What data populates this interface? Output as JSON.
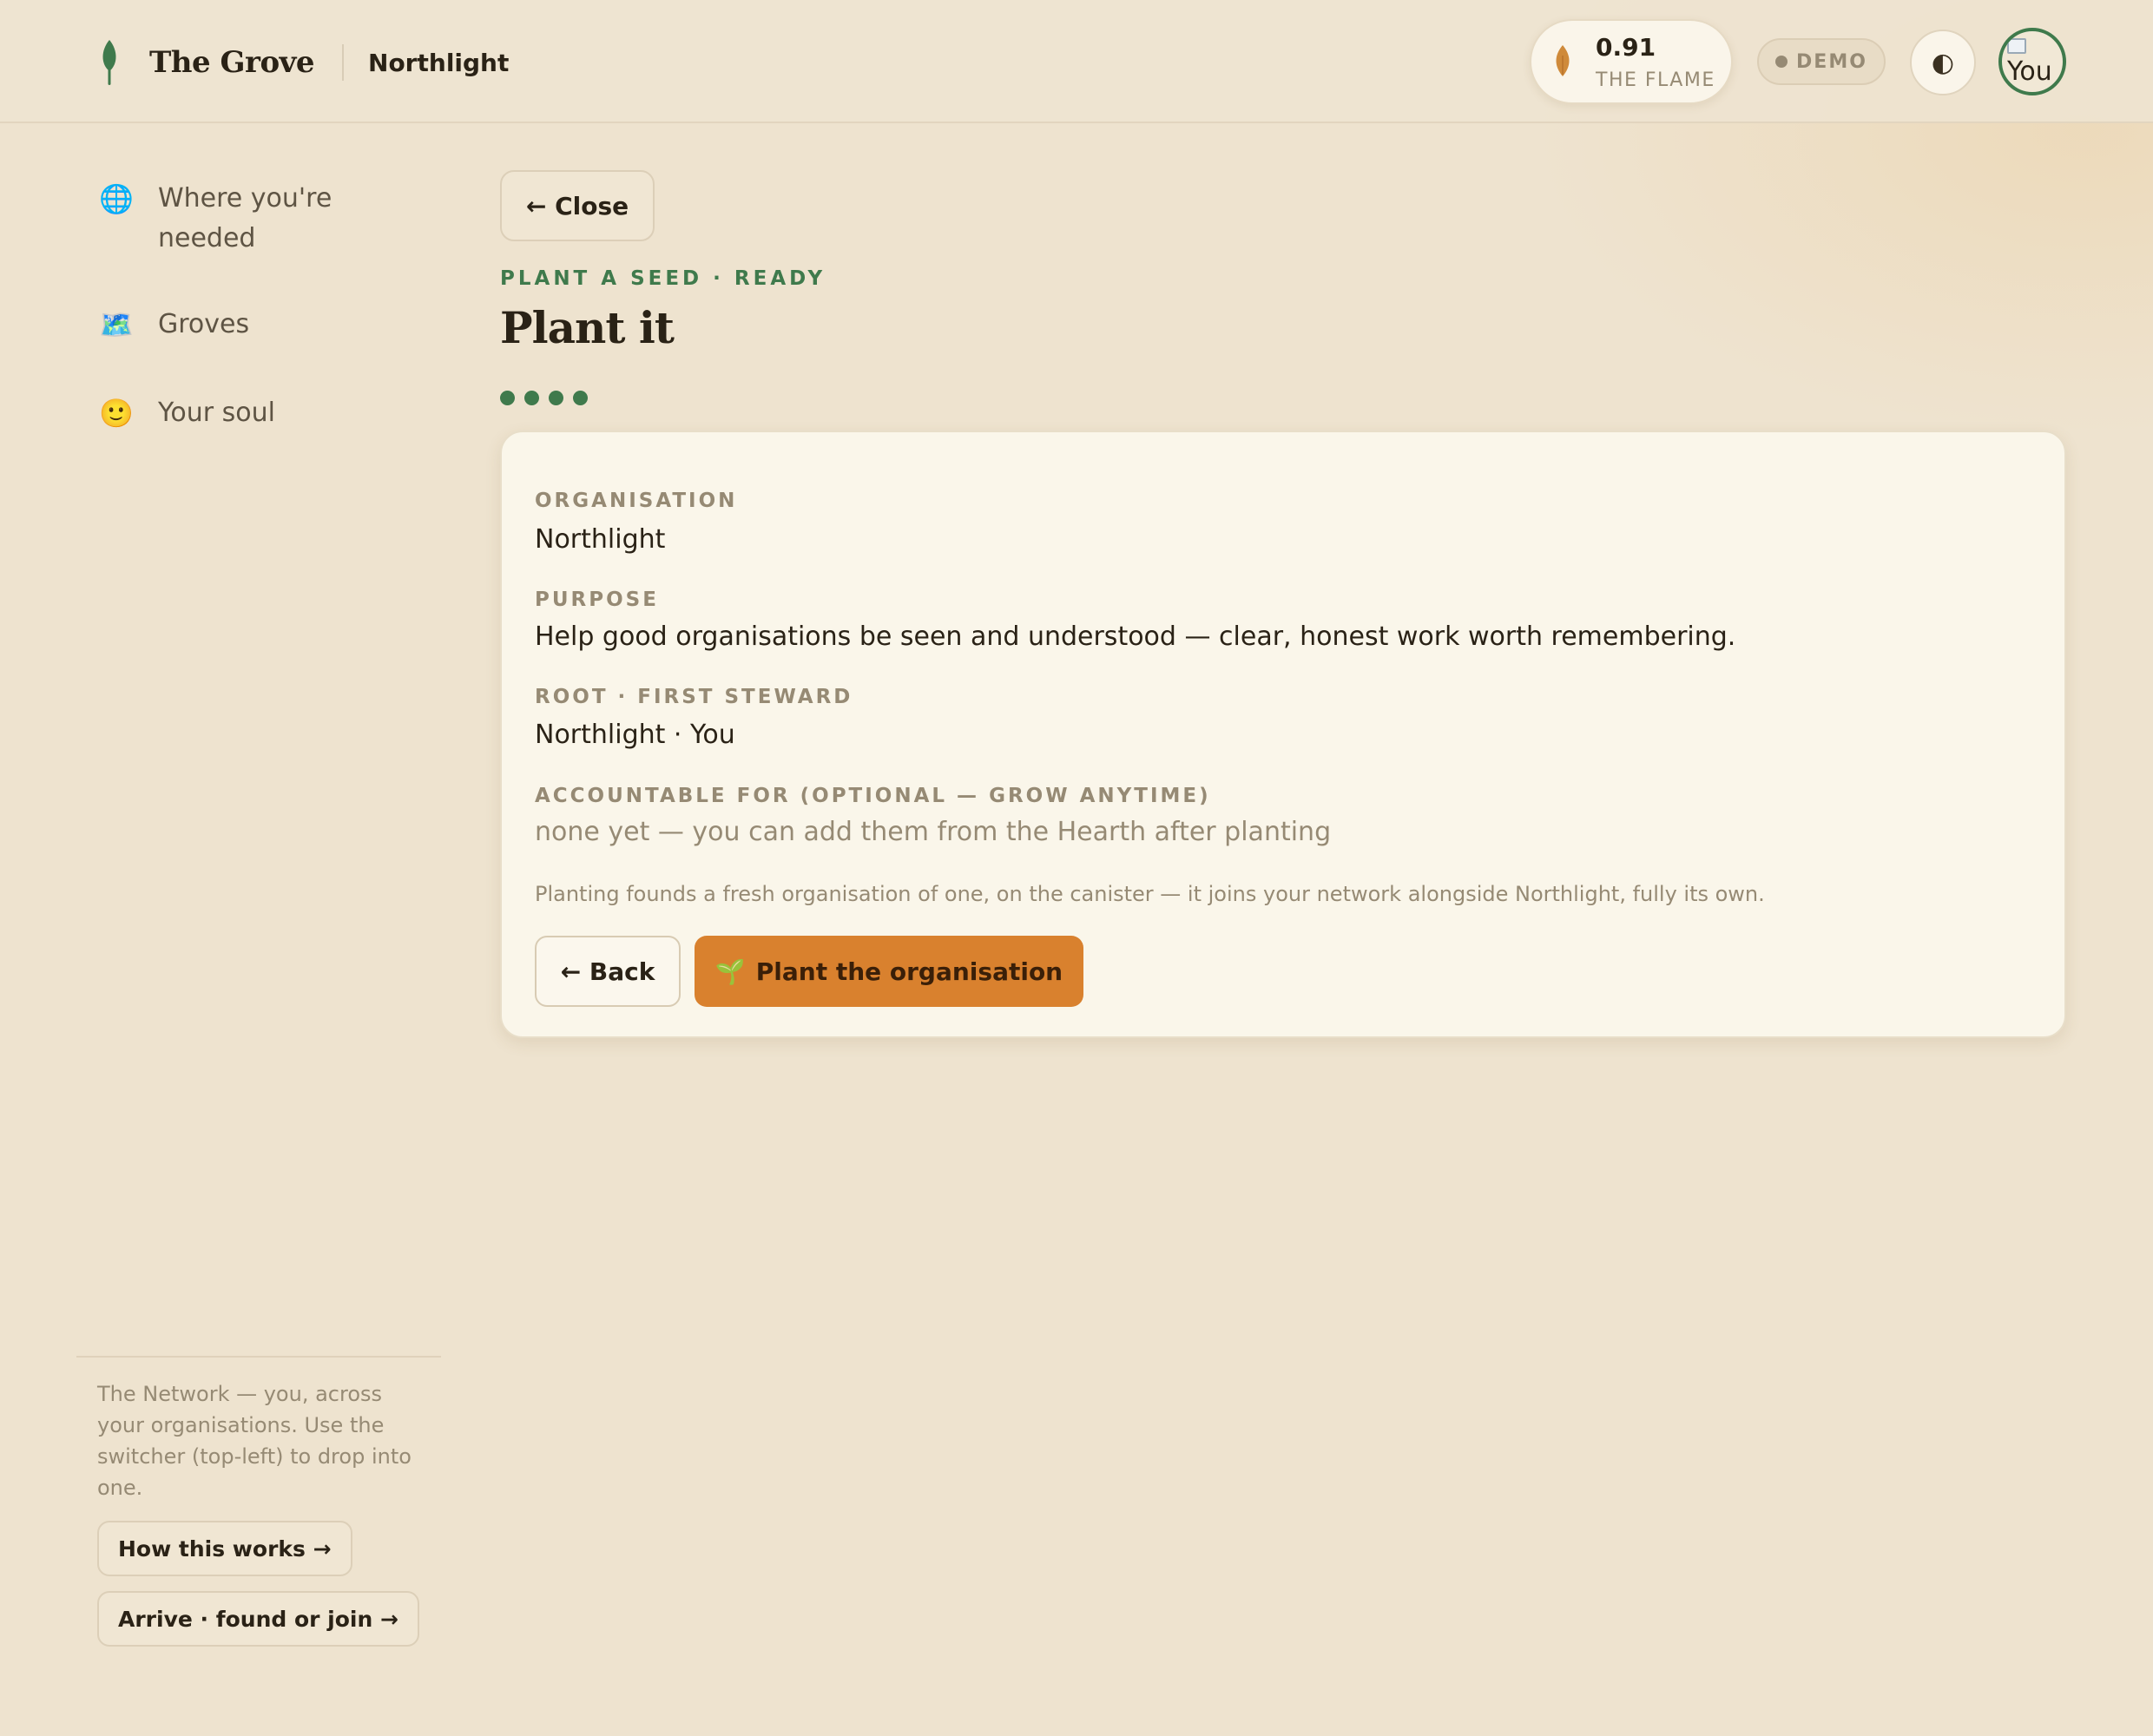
{
  "header": {
    "brand": "The Grove",
    "org": "Northlight",
    "flame": {
      "value": "0.91",
      "label": "THE FLAME"
    },
    "demo": "DEMO",
    "theme_icon": "◐",
    "avatar_alt": "You"
  },
  "sidebar": {
    "items": [
      {
        "icon": "🌐",
        "label": "Where you're needed"
      },
      {
        "icon": "🗺️",
        "label": "Groves"
      },
      {
        "icon": "🙂",
        "label": "Your soul"
      }
    ],
    "note": "The Network — you, across your organisations. Use the switcher (top-left) to drop into one.",
    "how_button": "How this works →",
    "arrive_button": "Arrive · found or join →"
  },
  "main": {
    "close": "← Close",
    "eyebrow": "PLANT A SEED · READY",
    "title": "Plant it",
    "steps_total": 4,
    "steps_done": 4,
    "card": {
      "org_label": "ORGANISATION",
      "org_value": "Northlight",
      "purpose_label": "PURPOSE",
      "purpose_value": "Help good organisations be seen and understood — clear, honest work worth remembering.",
      "root_label": "ROOT · FIRST STEWARD",
      "root_value": "Northlight · You",
      "accountable_label": "ACCOUNTABLE FOR (OPTIONAL — GROW ANYTIME)",
      "accountable_value": "none yet — you can add them from the Hearth after planting",
      "note": "Planting founds a fresh organisation of one, on the canister — it joins your network alongside Northlight, fully its own.",
      "back": "← Back",
      "plant_icon": "🌱",
      "plant": "Plant the organisation"
    }
  },
  "colors": {
    "accent_green": "#3f7a4c",
    "primary_orange": "#d9812e",
    "background": "#eee3cf",
    "card": "#faf6ea"
  }
}
